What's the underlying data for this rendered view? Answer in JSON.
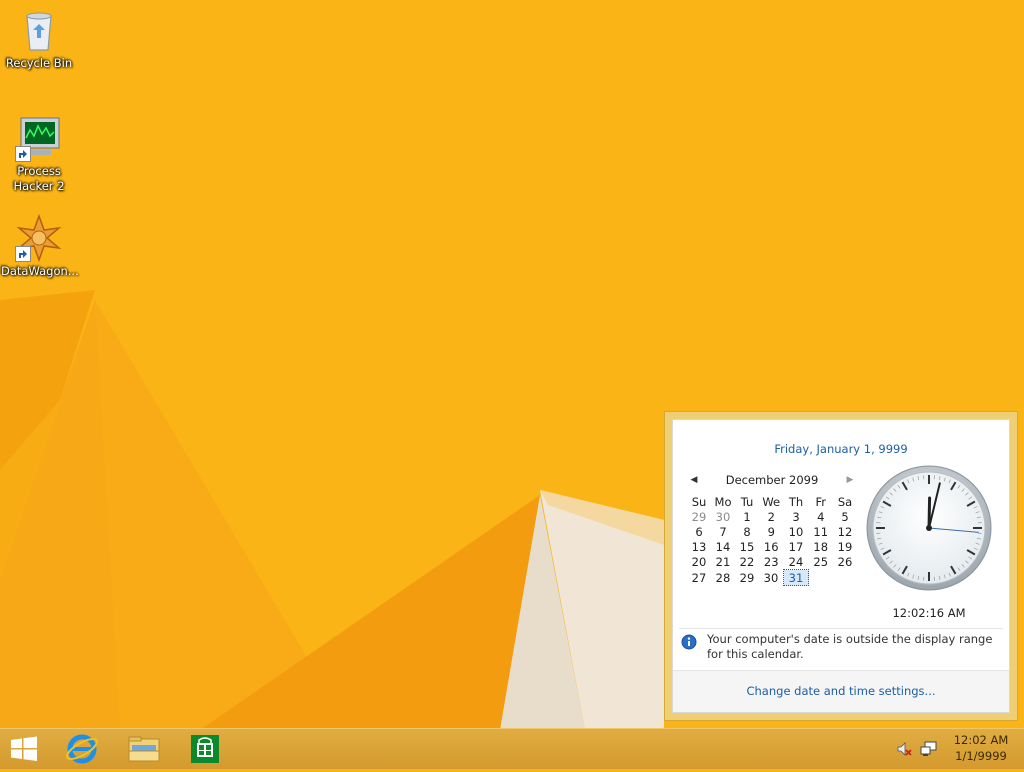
{
  "desktop": {
    "icons": [
      {
        "label": "Recycle Bin",
        "icon": "recycle-bin-icon"
      },
      {
        "label": "Process Hacker 2",
        "icon": "process-hacker-icon"
      },
      {
        "label": "DataWagon...",
        "icon": "datawagon-icon"
      }
    ]
  },
  "taskbar": {
    "pinned": [
      "start-icon",
      "internet-explorer-icon",
      "file-explorer-icon",
      "store-icon"
    ],
    "tray_icons": [
      "volume-muted-icon",
      "network-icon"
    ],
    "clock_time": "12:02 AM",
    "clock_date": "1/1/9999"
  },
  "flyout": {
    "long_date": "Friday, January 1, 9999",
    "month_label": "December 2099",
    "day_headers": [
      "Su",
      "Mo",
      "Tu",
      "We",
      "Th",
      "Fr",
      "Sa"
    ],
    "weeks": [
      [
        "29",
        "30",
        "1",
        "2",
        "3",
        "4",
        "5"
      ],
      [
        "6",
        "7",
        "8",
        "9",
        "10",
        "11",
        "12"
      ],
      [
        "13",
        "14",
        "15",
        "16",
        "17",
        "18",
        "19"
      ],
      [
        "20",
        "21",
        "22",
        "23",
        "24",
        "25",
        "26"
      ],
      [
        "27",
        "28",
        "29",
        "30",
        "31",
        "",
        ""
      ]
    ],
    "selected_day": "31",
    "digital_time": "12:02:16 AM",
    "clock_hands": {
      "hour": 0.0,
      "minute": 2,
      "second": 16
    },
    "info_message": "Your computer's date is outside the display range for this calendar.",
    "change_link": "Change date and time settings..."
  },
  "colors": {
    "wallpaper": "#fbb415",
    "accent_link": "#1c5ea8",
    "taskbar": "#d9a336"
  }
}
